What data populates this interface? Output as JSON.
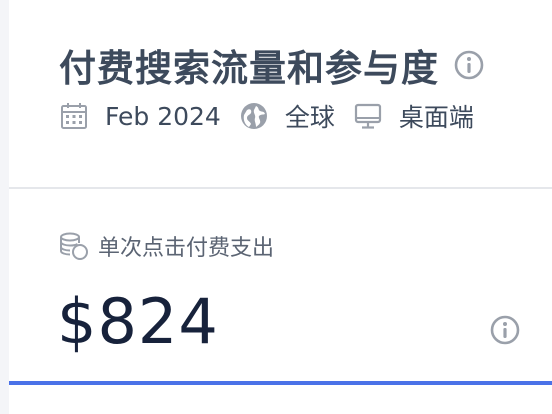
{
  "colors": {
    "accent": "#4a72e8",
    "text_dark": "#17223b",
    "text_title": "#3d4a5c",
    "icon_gray": "#9aa0aa"
  },
  "header": {
    "title": "付费搜索流量和参与度",
    "title_icon": "info-circle-icon",
    "date_icon": "calendar-icon",
    "date": "Feb 2024",
    "region_icon": "globe-icon",
    "region": "全球",
    "device_icon": "desktop-icon",
    "device": "桌面端"
  },
  "metric": {
    "icon": "coins-icon",
    "label": "单次点击付费支出",
    "value": "$824",
    "info_icon": "info-circle-icon"
  }
}
